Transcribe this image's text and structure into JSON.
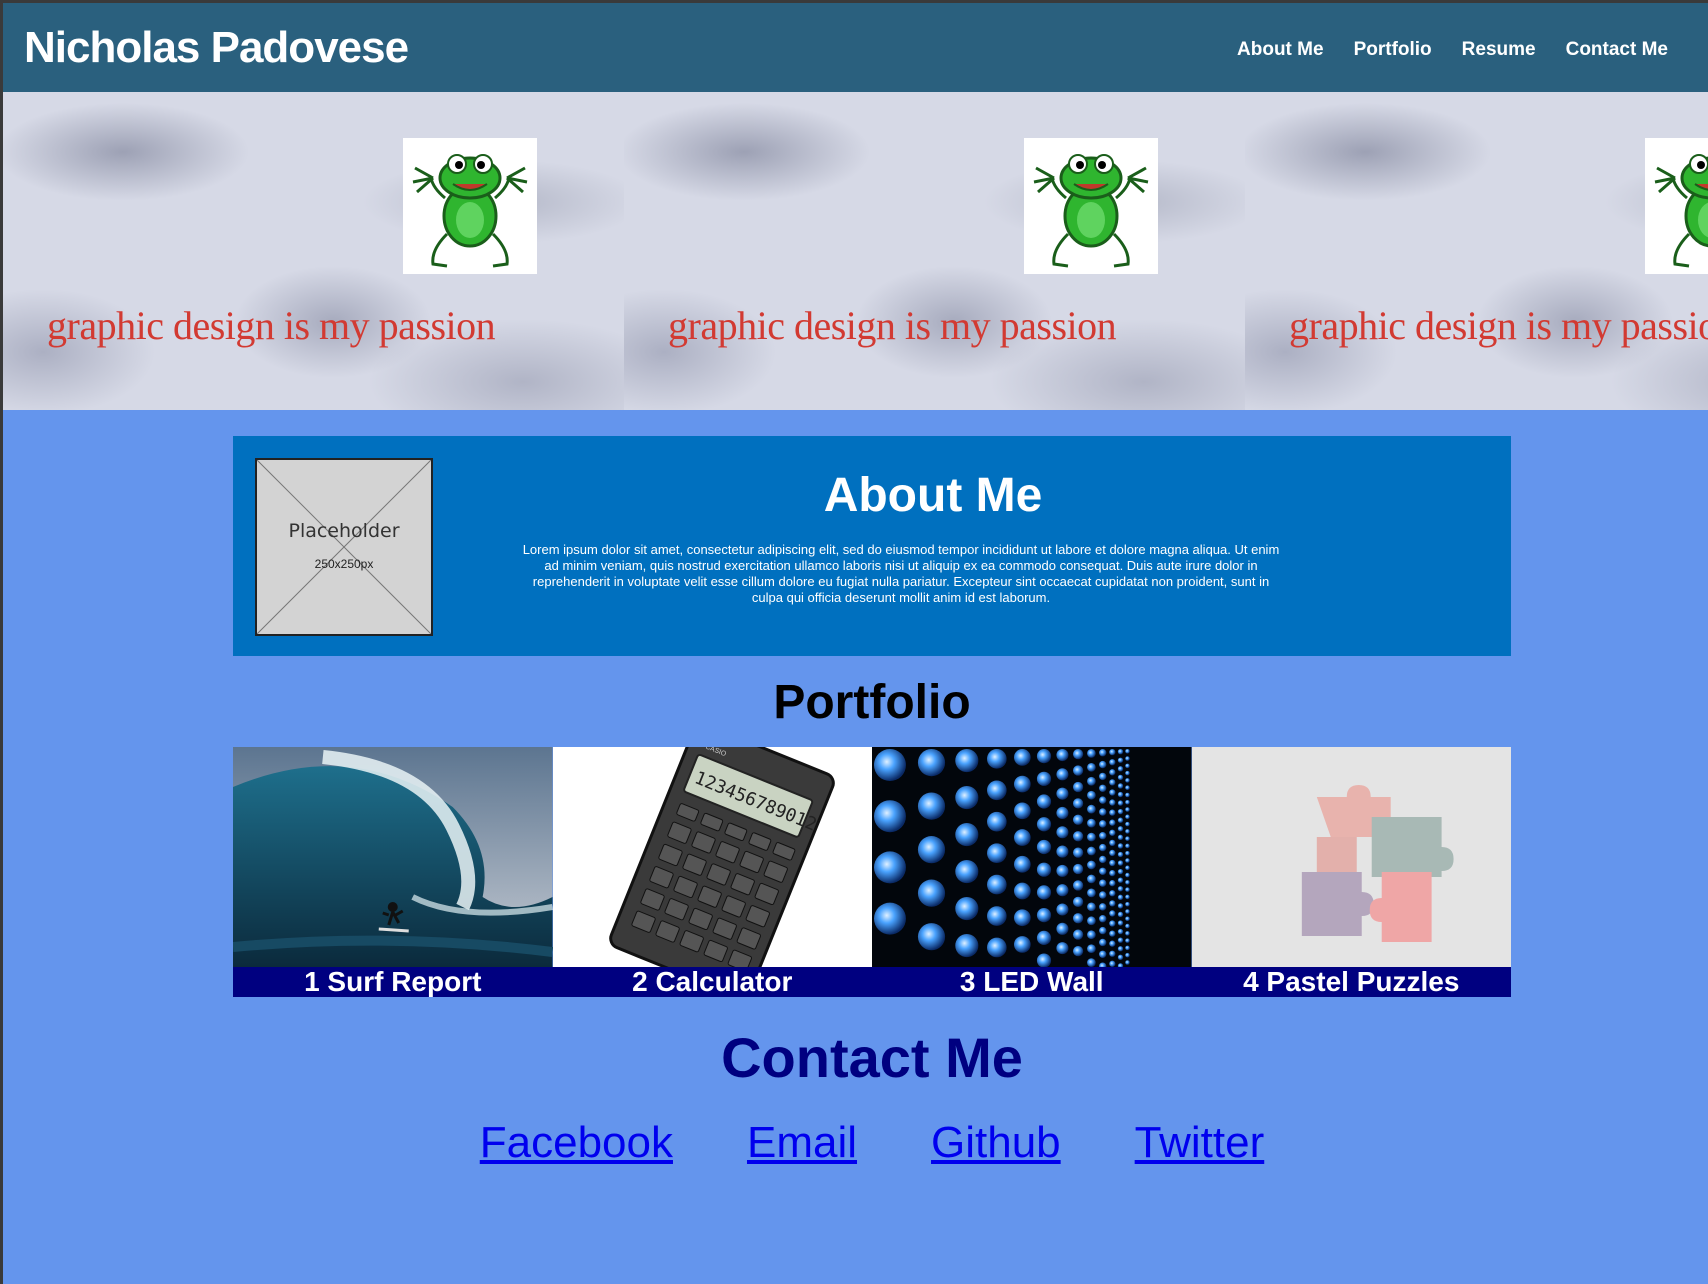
{
  "header": {
    "title": "Nicholas Padovese",
    "nav": [
      "About Me",
      "Portfolio",
      "Resume",
      "Contact Me"
    ]
  },
  "hero": {
    "tagline": "graphic design is my passion"
  },
  "about": {
    "heading": "About Me",
    "placeholder_label": "Placeholder",
    "placeholder_size": "250x250px",
    "text": "Lorem ipsum dolor sit amet, consectetur adipiscing elit, sed do eiusmod tempor incididunt ut labore et dolore magna aliqua. Ut enim ad minim veniam, quis nostrud exercitation ullamco laboris nisi ut aliquip ex ea commodo consequat. Duis aute irure dolor in reprehenderit in voluptate velit esse cillum dolore eu fugiat nulla pariatur. Excepteur sint occaecat cupidatat non proident, sunt in culpa qui officia deserunt mollit anim id est laborum."
  },
  "portfolio": {
    "heading": "Portfolio",
    "items": [
      {
        "caption": "1 Surf Report"
      },
      {
        "caption": "2 Calculator"
      },
      {
        "caption": "3 LED Wall"
      },
      {
        "caption": "4 Pastel Puzzles"
      }
    ]
  },
  "contact": {
    "heading": "Contact Me",
    "links": [
      "Facebook",
      "Email",
      "Github",
      "Twitter"
    ]
  },
  "colors": {
    "header_bg": "#2A607E",
    "page_bg": "#6495ED",
    "about_bg": "#0070BF",
    "caption_bg": "#000080",
    "contact_heading": "#000080",
    "link": "#0000EE"
  }
}
